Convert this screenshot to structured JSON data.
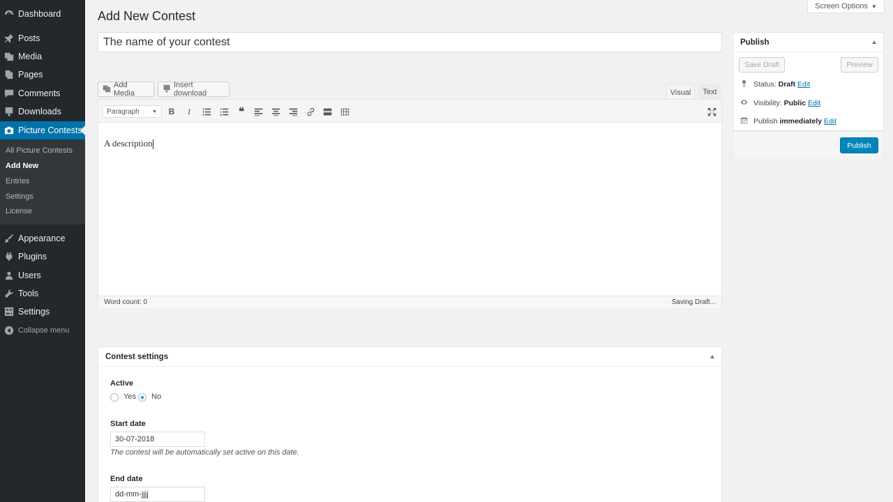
{
  "sidebar": {
    "items": [
      {
        "label": "Dashboard",
        "icon": "dashboard-icon"
      },
      {
        "label": "Posts",
        "icon": "pin-icon"
      },
      {
        "label": "Media",
        "icon": "media-icon"
      },
      {
        "label": "Pages",
        "icon": "pages-icon"
      },
      {
        "label": "Comments",
        "icon": "comments-icon"
      },
      {
        "label": "Downloads",
        "icon": "download-icon"
      },
      {
        "label": "Picture Contests",
        "icon": "camera-icon"
      }
    ],
    "submenu": [
      "All Picture Contests",
      "Add New",
      "Entries",
      "Settings",
      "License"
    ],
    "lower_items": [
      {
        "label": "Appearance",
        "icon": "brush-icon"
      },
      {
        "label": "Plugins",
        "icon": "plugin-icon"
      },
      {
        "label": "Users",
        "icon": "users-icon"
      },
      {
        "label": "Tools",
        "icon": "wrench-icon"
      },
      {
        "label": "Settings",
        "icon": "settings-icon"
      }
    ],
    "collapse_label": "Collapse menu"
  },
  "header": {
    "screen_options": "Screen Options",
    "page_title": "Add New Contest"
  },
  "post": {
    "title_value": "The name of your contest"
  },
  "editor": {
    "add_media": "Add Media",
    "insert_download": "Insert download",
    "tab_visual": "Visual",
    "tab_text": "Text",
    "format": "Paragraph",
    "content": "A description",
    "word_count": "Word count: 0",
    "save_status": "Saving Draft..."
  },
  "publish": {
    "title": "Publish",
    "save_draft": "Save Draft",
    "preview": "Preview",
    "status_label": "Status:",
    "status_value": "Draft",
    "visibility_label": "Visibility:",
    "visibility_value": "Public",
    "publish_label": "Publish",
    "publish_value": "immediately",
    "edit": "Edit",
    "publish_button": "Publish"
  },
  "contest_settings": {
    "title": "Contest settings",
    "active_label": "Active",
    "yes": "Yes",
    "no": "No",
    "start_date_label": "Start date",
    "start_date_value": "30-07-2018",
    "start_date_help": "The contest will be automatically set active on this date.",
    "end_date_label": "End date",
    "end_date_value": "dd-mm-jjjj"
  }
}
